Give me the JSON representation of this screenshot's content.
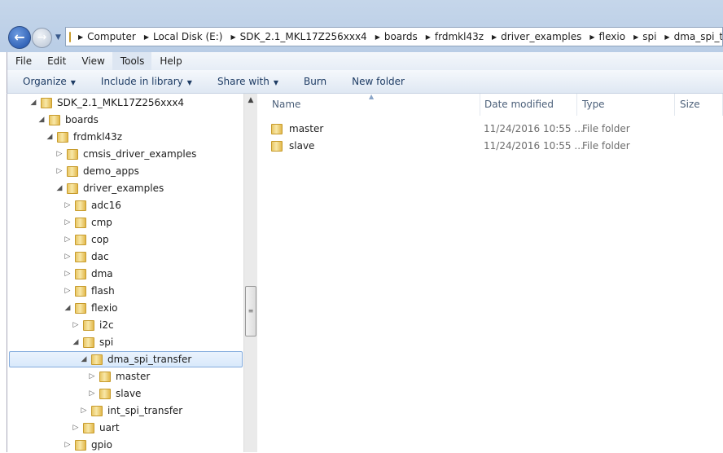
{
  "address": {
    "crumbs": [
      "Computer",
      "Local Disk (E:)",
      "SDK_2.1_MKL17Z256xxx4",
      "boards",
      "frdmkl43z",
      "driver_examples",
      "flexio",
      "spi",
      "dma_spi_transfer"
    ]
  },
  "menu": [
    "File",
    "Edit",
    "View",
    "Tools",
    "Help"
  ],
  "toolbar": {
    "organize": "Organize",
    "include": "Include in library",
    "share": "Share with",
    "burn": "Burn",
    "new_folder": "New folder"
  },
  "tree": [
    {
      "label": "SDK_2.1_MKL17Z256xxx4",
      "level": 0,
      "expanded": true
    },
    {
      "label": "boards",
      "level": 1,
      "expanded": true
    },
    {
      "label": "frdmkl43z",
      "level": 2,
      "expanded": true
    },
    {
      "label": "cmsis_driver_examples",
      "level": 3,
      "expanded": false
    },
    {
      "label": "demo_apps",
      "level": 3,
      "expanded": false
    },
    {
      "label": "driver_examples",
      "level": 3,
      "expanded": true
    },
    {
      "label": "adc16",
      "level": 4,
      "expanded": false
    },
    {
      "label": "cmp",
      "level": 4,
      "expanded": false
    },
    {
      "label": "cop",
      "level": 4,
      "expanded": false
    },
    {
      "label": "dac",
      "level": 4,
      "expanded": false
    },
    {
      "label": "dma",
      "level": 4,
      "expanded": false
    },
    {
      "label": "flash",
      "level": 4,
      "expanded": false
    },
    {
      "label": "flexio",
      "level": 4,
      "expanded": true
    },
    {
      "label": "i2c",
      "level": 5,
      "expanded": false
    },
    {
      "label": "spi",
      "level": 5,
      "expanded": true
    },
    {
      "label": "dma_spi_transfer",
      "level": 6,
      "expanded": true,
      "selected": true
    },
    {
      "label": "master",
      "level": 7,
      "expanded": false
    },
    {
      "label": "slave",
      "level": 7,
      "expanded": false
    },
    {
      "label": "int_spi_transfer",
      "level": 6,
      "expanded": false
    },
    {
      "label": "uart",
      "level": 5,
      "expanded": false
    },
    {
      "label": "gpio",
      "level": 4,
      "expanded": false
    }
  ],
  "columns": {
    "name": "Name",
    "date": "Date modified",
    "type": "Type",
    "size": "Size"
  },
  "files": [
    {
      "name": "master",
      "date": "11/24/2016 10:55 ...",
      "type": "File folder"
    },
    {
      "name": "slave",
      "date": "11/24/2016 10:55 ...",
      "type": "File folder"
    }
  ]
}
